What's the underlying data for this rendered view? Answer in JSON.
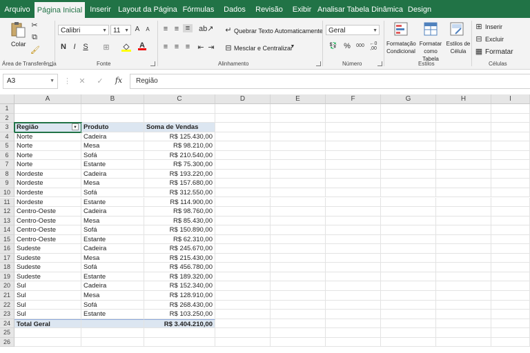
{
  "tabs": [
    "Arquivo",
    "Página Inicial",
    "Inserir",
    "Layout da Página",
    "Fórmulas",
    "Dados",
    "Revisão",
    "Exibir",
    "Analisar Tabela Dinâmica",
    "Design"
  ],
  "active_tab": "Página Inicial",
  "ribbon": {
    "clipboard": {
      "paste_label": "Colar",
      "group_label": "Área de Transferência"
    },
    "font": {
      "name": "Calibri",
      "size": "11",
      "bold": "N",
      "italic": "I",
      "underline": "S",
      "grow": "A",
      "shrink": "A",
      "font_color": "A",
      "group_label": "Fonte"
    },
    "alignment": {
      "wrap_label": "Quebrar Texto Automaticamente",
      "merge_label": "Mesclar e Centralizar",
      "group_label": "Alinhamento"
    },
    "number": {
      "format": "Geral",
      "percent": "%",
      "comma": "000",
      "group_label": "Número"
    },
    "styles": {
      "conditional_line1": "Formatação",
      "conditional_line2": "Condicional",
      "table_line1": "Formatar",
      "table_line2": "como Tabela",
      "cell_line1": "Estilos de",
      "cell_line2": "Célula",
      "group_label": "Estilos"
    },
    "cells": {
      "insert": "Inserir",
      "delete": "Excluir",
      "format": "Formatar",
      "group_label": "Células"
    }
  },
  "formula_bar": {
    "name_box": "A3",
    "fx": "fx",
    "value": "Região"
  },
  "columns": [
    "A",
    "B",
    "C",
    "D",
    "E",
    "F",
    "G",
    "H",
    "I"
  ],
  "row_numbers": [
    "1",
    "2",
    "3",
    "4",
    "5",
    "6",
    "7",
    "8",
    "9",
    "10",
    "11",
    "12",
    "13",
    "14",
    "15",
    "16",
    "17",
    "18",
    "19",
    "20",
    "21",
    "22",
    "23",
    "24",
    "25",
    "26"
  ],
  "pivot": {
    "headers": [
      "Região",
      "Produto",
      "Soma de Vendas"
    ],
    "rows": [
      [
        "Norte",
        "Cadeira",
        "R$ 125.430,00"
      ],
      [
        "Norte",
        "Mesa",
        "R$ 98.210,00"
      ],
      [
        "Norte",
        "Sofá",
        "R$ 210.540,00"
      ],
      [
        "Norte",
        "Estante",
        "R$ 75.300,00"
      ],
      [
        "Nordeste",
        "Cadeira",
        "R$ 193.220,00"
      ],
      [
        "Nordeste",
        "Mesa",
        "R$ 157.680,00"
      ],
      [
        "Nordeste",
        "Sofá",
        "R$ 312.550,00"
      ],
      [
        "Nordeste",
        "Estante",
        "R$ 114.900,00"
      ],
      [
        "Centro-Oeste",
        "Cadeira",
        "R$ 98.760,00"
      ],
      [
        "Centro-Oeste",
        "Mesa",
        "R$ 85.430,00"
      ],
      [
        "Centro-Oeste",
        "Sofá",
        "R$ 150.890,00"
      ],
      [
        "Centro-Oeste",
        "Estante",
        "R$ 62.310,00"
      ],
      [
        "Sudeste",
        "Cadeira",
        "R$ 245.670,00"
      ],
      [
        "Sudeste",
        "Mesa",
        "R$ 215.430,00"
      ],
      [
        "Sudeste",
        "Sofá",
        "R$ 456.780,00"
      ],
      [
        "Sudeste",
        "Estante",
        "R$ 189.320,00"
      ],
      [
        "Sul",
        "Cadeira",
        "R$ 152.340,00"
      ],
      [
        "Sul",
        "Mesa",
        "R$ 128.910,00"
      ],
      [
        "Sul",
        "Sofá",
        "R$ 268.430,00"
      ],
      [
        "Sul",
        "Estante",
        "R$ 103.250,00"
      ]
    ],
    "total_label": "Total Geral",
    "total_value": "R$ 3.404.210,00"
  },
  "colors": {
    "accent": "#217346",
    "pivot_header": "#dce6f1"
  }
}
